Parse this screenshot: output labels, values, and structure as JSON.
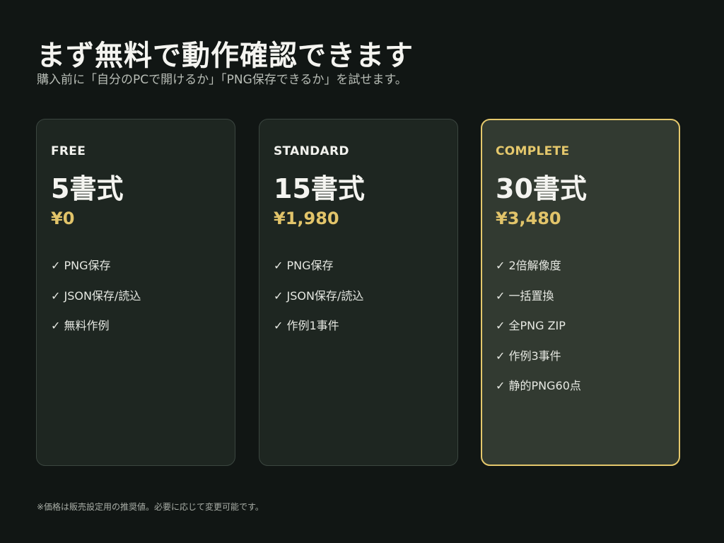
{
  "header": {
    "title": "まず無料で動作確認できます",
    "subtitle": "購入前に「自分のPCで開けるか」「PNG保存できるか」を試せます。"
  },
  "plans": [
    {
      "name": "FREE",
      "count": "5書式",
      "price": "¥0",
      "features": [
        "✓ PNG保存",
        "✓ JSON保存/読込",
        "✓ 無料作例"
      ]
    },
    {
      "name": "STANDARD",
      "count": "15書式",
      "price": "¥1,980",
      "features": [
        "✓ PNG保存",
        "✓ JSON保存/読込",
        "✓ 作例1事件"
      ]
    },
    {
      "name": "COMPLETE",
      "count": "30書式",
      "price": "¥3,480",
      "features": [
        "✓ 2倍解像度",
        "✓ 一括置換",
        "✓ 全PNG ZIP",
        "✓ 作例3事件",
        "✓ 静的PNG60点"
      ],
      "highlighted": true
    }
  ],
  "footnote": "※価格は販売設定用の推奨値。必要に応じて変更可能です。",
  "colors": {
    "background": "#111614",
    "card": "#1e2621",
    "highlight_card": "#323a31",
    "accent_gold": "#e5c86c"
  }
}
